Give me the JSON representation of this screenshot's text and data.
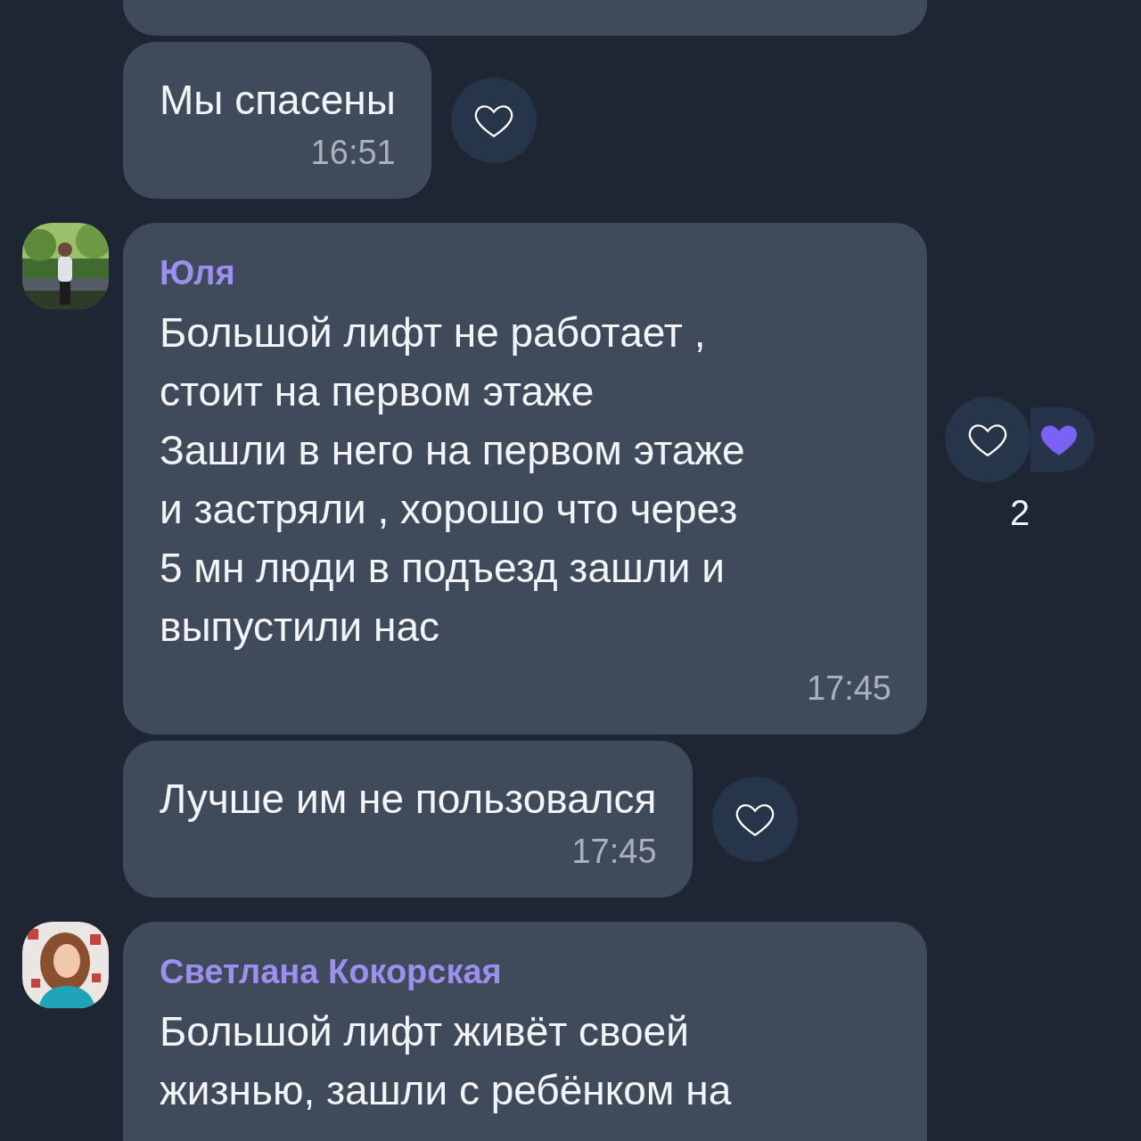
{
  "messages": [
    {
      "kind": "cut"
    },
    {
      "kind": "continued",
      "text": "Мы спасены",
      "time": "16:51",
      "reaction": {
        "kind": "button"
      }
    },
    {
      "kind": "first",
      "author": "Юля",
      "text": "Большой лифт не работает ,\nстоит на первом этаже\nЗашли в него на первом этаже\nи застряли , хорошо что через\n5 мн люди в подъезд зашли и\nвыпустили нас",
      "time": "17:45",
      "reaction": {
        "kind": "group",
        "liked": true,
        "count": "2"
      }
    },
    {
      "kind": "continued",
      "text": "Лучше им не пользовался",
      "time": "17:45",
      "reaction": {
        "kind": "button"
      }
    },
    {
      "kind": "first",
      "author": "Светлана Кокорская",
      "text": "Большой лифт живёт своей\nжизнью, зашли с ребёнком на"
    }
  ]
}
